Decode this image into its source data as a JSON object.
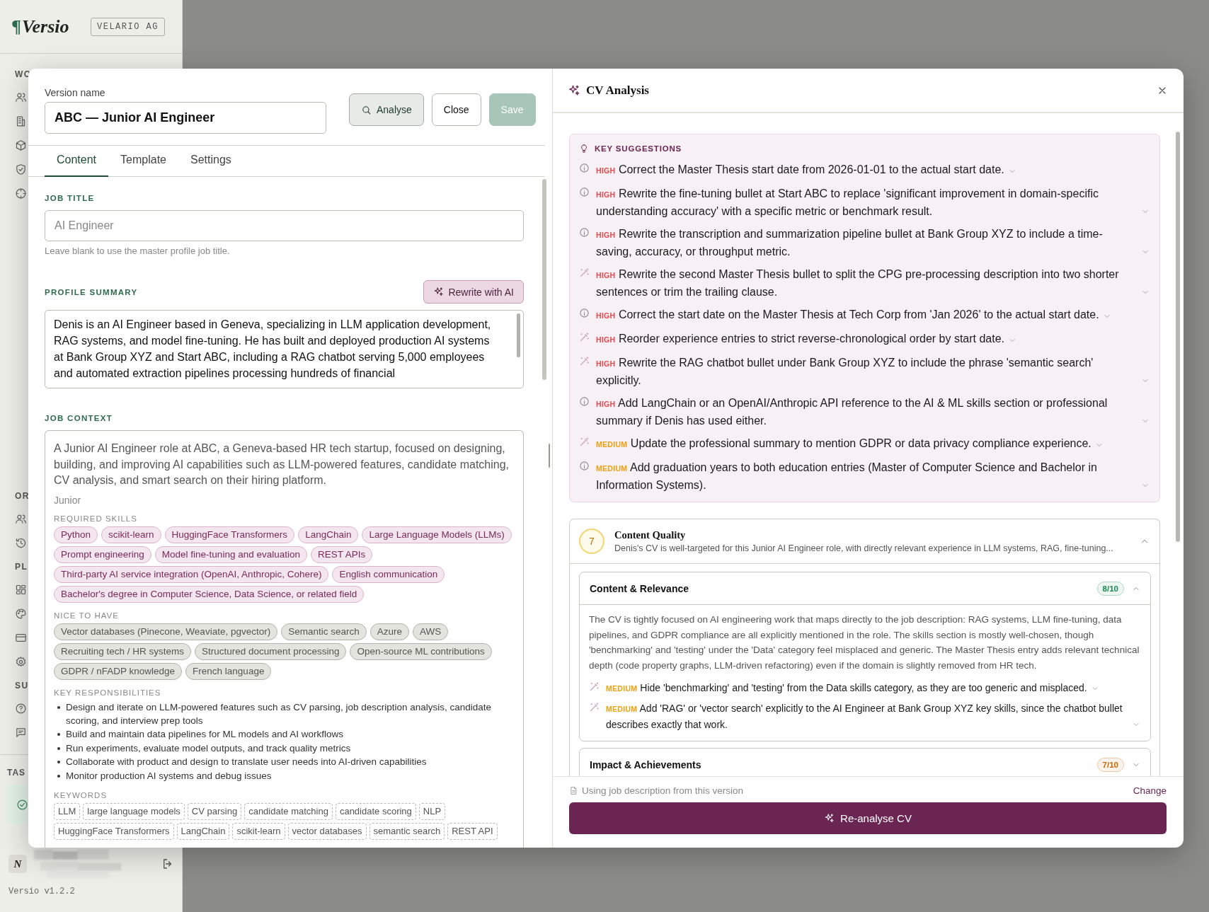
{
  "sidebar": {
    "logo_mark": "¶",
    "logo": "Versio",
    "org_badge": "VELARIO AG",
    "sections": [
      {
        "label": "WO"
      },
      {
        "label": "OR"
      },
      {
        "label": "PL"
      },
      {
        "label": "SU"
      }
    ],
    "tasks_label": "TAS",
    "user": {
      "avatar": "N"
    },
    "version": "Versio v1.2.2"
  },
  "editor": {
    "version_name_label": "Version name",
    "version_name": "ABC — Junior AI Engineer",
    "buttons": [
      {
        "label": "Analyse",
        "kind": "search",
        "disabled": false
      },
      {
        "label": "Close",
        "kind": "plain",
        "disabled": false
      },
      {
        "label": "Save",
        "kind": "primary",
        "disabled": true
      }
    ],
    "tabs": [
      {
        "label": "Content",
        "selected": true
      },
      {
        "label": "Template",
        "selected": false
      },
      {
        "label": "Settings",
        "selected": false
      }
    ],
    "job_title": {
      "label": "JOB TITLE",
      "placeholder": "AI Engineer",
      "hint": "Leave blank to use the master profile job title."
    },
    "profile_summary": {
      "label": "PROFILE SUMMARY",
      "action": "Rewrite with AI",
      "value": "Denis is an AI Engineer based in Geneva, specializing in LLM application development, RAG systems, and model fine-tuning. He has built and deployed production AI systems at Bank Group XYZ and Start ABC, including a RAG chatbot serving 5,000 employees and automated extraction pipelines processing hundreds of financial"
    },
    "job_context": {
      "label": "JOB CONTEXT",
      "description": "A Junior AI Engineer role at ABC, a Geneva-based HR tech startup, focused on designing, building, and improving AI capabilities such as LLM-powered features, candidate matching, CV analysis, and smart search on their hiring platform.",
      "seniority": "Junior",
      "required_skills": {
        "label": "REQUIRED SKILLS",
        "items": [
          "Python",
          "scikit-learn",
          "HuggingFace Transformers",
          "LangChain",
          "Large Language Models (LLMs)",
          "Prompt engineering",
          "Model fine-tuning and evaluation",
          "REST APIs",
          "Third-party AI service integration (OpenAI, Anthropic, Cohere)",
          "English communication",
          "Bachelor's degree in Computer Science, Data Science, or related field"
        ]
      },
      "nice_to_have": {
        "label": "NICE TO HAVE",
        "items": [
          "Vector databases (Pinecone, Weaviate, pgvector)",
          "Semantic search",
          "Azure",
          "AWS",
          "Recruiting tech / HR systems",
          "Structured document processing",
          "Open-source ML contributions",
          "GDPR / nFADP knowledge",
          "French language"
        ]
      },
      "responsibilities": {
        "label": "KEY RESPONSIBILITIES",
        "items": [
          "Design and iterate on LLM-powered features such as CV parsing, job description analysis, candidate scoring, and interview prep tools",
          "Build and maintain data pipelines for ML models and AI workflows",
          "Run experiments, evaluate model outputs, and track quality metrics",
          "Collaborate with product and design to translate user needs into AI-driven capabilities",
          "Monitor production AI systems and debug issues"
        ]
      },
      "keywords": {
        "label": "KEYWORDS",
        "items": [
          "LLM",
          "large language models",
          "CV parsing",
          "candidate matching",
          "candidate scoring",
          "NLP",
          "HuggingFace Transformers",
          "LangChain",
          "scikit-learn",
          "vector databases",
          "semantic search",
          "REST API"
        ]
      }
    }
  },
  "analysis": {
    "title": "CV Analysis",
    "key_suggestions": {
      "label": "KEY SUGGESTIONS",
      "items": [
        {
          "kind": "info",
          "urgent": true,
          "priority": "HIGH",
          "text": "Correct the Master Thesis start date from 2026-01-01 to the actual start date."
        },
        {
          "kind": "info",
          "urgent": true,
          "priority": "HIGH",
          "text": "Rewrite the fine-tuning bullet at Start ABC to replace 'significant improvement in domain-specific understanding accuracy' with a specific metric or benchmark result."
        },
        {
          "kind": "info",
          "urgent": true,
          "priority": "HIGH",
          "text": "Rewrite the transcription and summarization pipeline bullet at Bank Group XYZ to include a time-saving, accuracy, or throughput metric."
        },
        {
          "kind": "fix",
          "urgent": true,
          "priority": "HIGH",
          "text": "Rewrite the second Master Thesis bullet to split the CPG pre-processing description into two shorter sentences or trim the trailing clause."
        },
        {
          "kind": "info",
          "urgent": true,
          "priority": "HIGH",
          "text": "Correct the start date on the Master Thesis at Tech Corp from 'Jan 2026' to the actual start date."
        },
        {
          "kind": "fix",
          "urgent": true,
          "priority": "HIGH",
          "text": "Reorder experience entries to strict reverse-chronological order by start date."
        },
        {
          "kind": "fix",
          "urgent": true,
          "priority": "HIGH",
          "text": "Rewrite the RAG chatbot bullet under Bank Group XYZ to include the phrase 'semantic search' explicitly."
        },
        {
          "kind": "info",
          "urgent": true,
          "priority": "HIGH",
          "text": "Add LangChain or an OpenAI/Anthropic API reference to the AI & ML skills section or professional summary if Denis has used either."
        },
        {
          "kind": "fix",
          "urgent": false,
          "priority": "MEDIUM",
          "text": "Update the professional summary to mention GDPR or data privacy compliance experience."
        },
        {
          "kind": "info",
          "urgent": false,
          "priority": "MEDIUM",
          "text": "Add graduation years to both education entries (Master of Computer Science and Bachelor in Information Systems)."
        }
      ]
    },
    "categories": [
      {
        "score": "7",
        "title": "Content Quality",
        "summary": "Denis's CV is well-targeted for this Junior AI Engineer role, with directly relevant experience in LLM systems, RAG, fine-tuning...",
        "expanded": true,
        "sections": [
          {
            "title": "Content & Relevance",
            "score": "8/10",
            "color": "#1a8a53",
            "expanded": true,
            "text": "The CV is tightly focused on AI engineering work that maps directly to the job description: RAG systems, LLM fine-tuning, data pipelines, and GDPR compliance are all explicitly mentioned in the role. The skills section is mostly well-chosen, though 'benchmarking' and 'testing' under the 'Data' category feel misplaced and generic. The Master Thesis entry adds relevant technical depth (code property graphs, LLM-driven refactoring) even if the domain is slightly removed from HR tech.",
            "suggestions": [
              {
                "kind": "fix",
                "urgent": false,
                "priority": "MEDIUM",
                "text": "Hide 'benchmarking' and 'testing' from the Data skills category, as they are too generic and misplaced."
              },
              {
                "kind": "fix",
                "urgent": false,
                "priority": "MEDIUM",
                "text": "Add 'RAG' or 'vector search' explicitly to the AI Engineer at Bank Group XYZ key skills, since the chatbot bullet describes exactly that work."
              }
            ]
          },
          {
            "title": "Impact & Achievements",
            "score": "7/10",
            "color": "#c76a00",
            "expanded": false
          }
        ]
      }
    ],
    "footer": {
      "note": "Using job description from this version",
      "change": "Change",
      "action": "Re-analyse CV"
    }
  }
}
